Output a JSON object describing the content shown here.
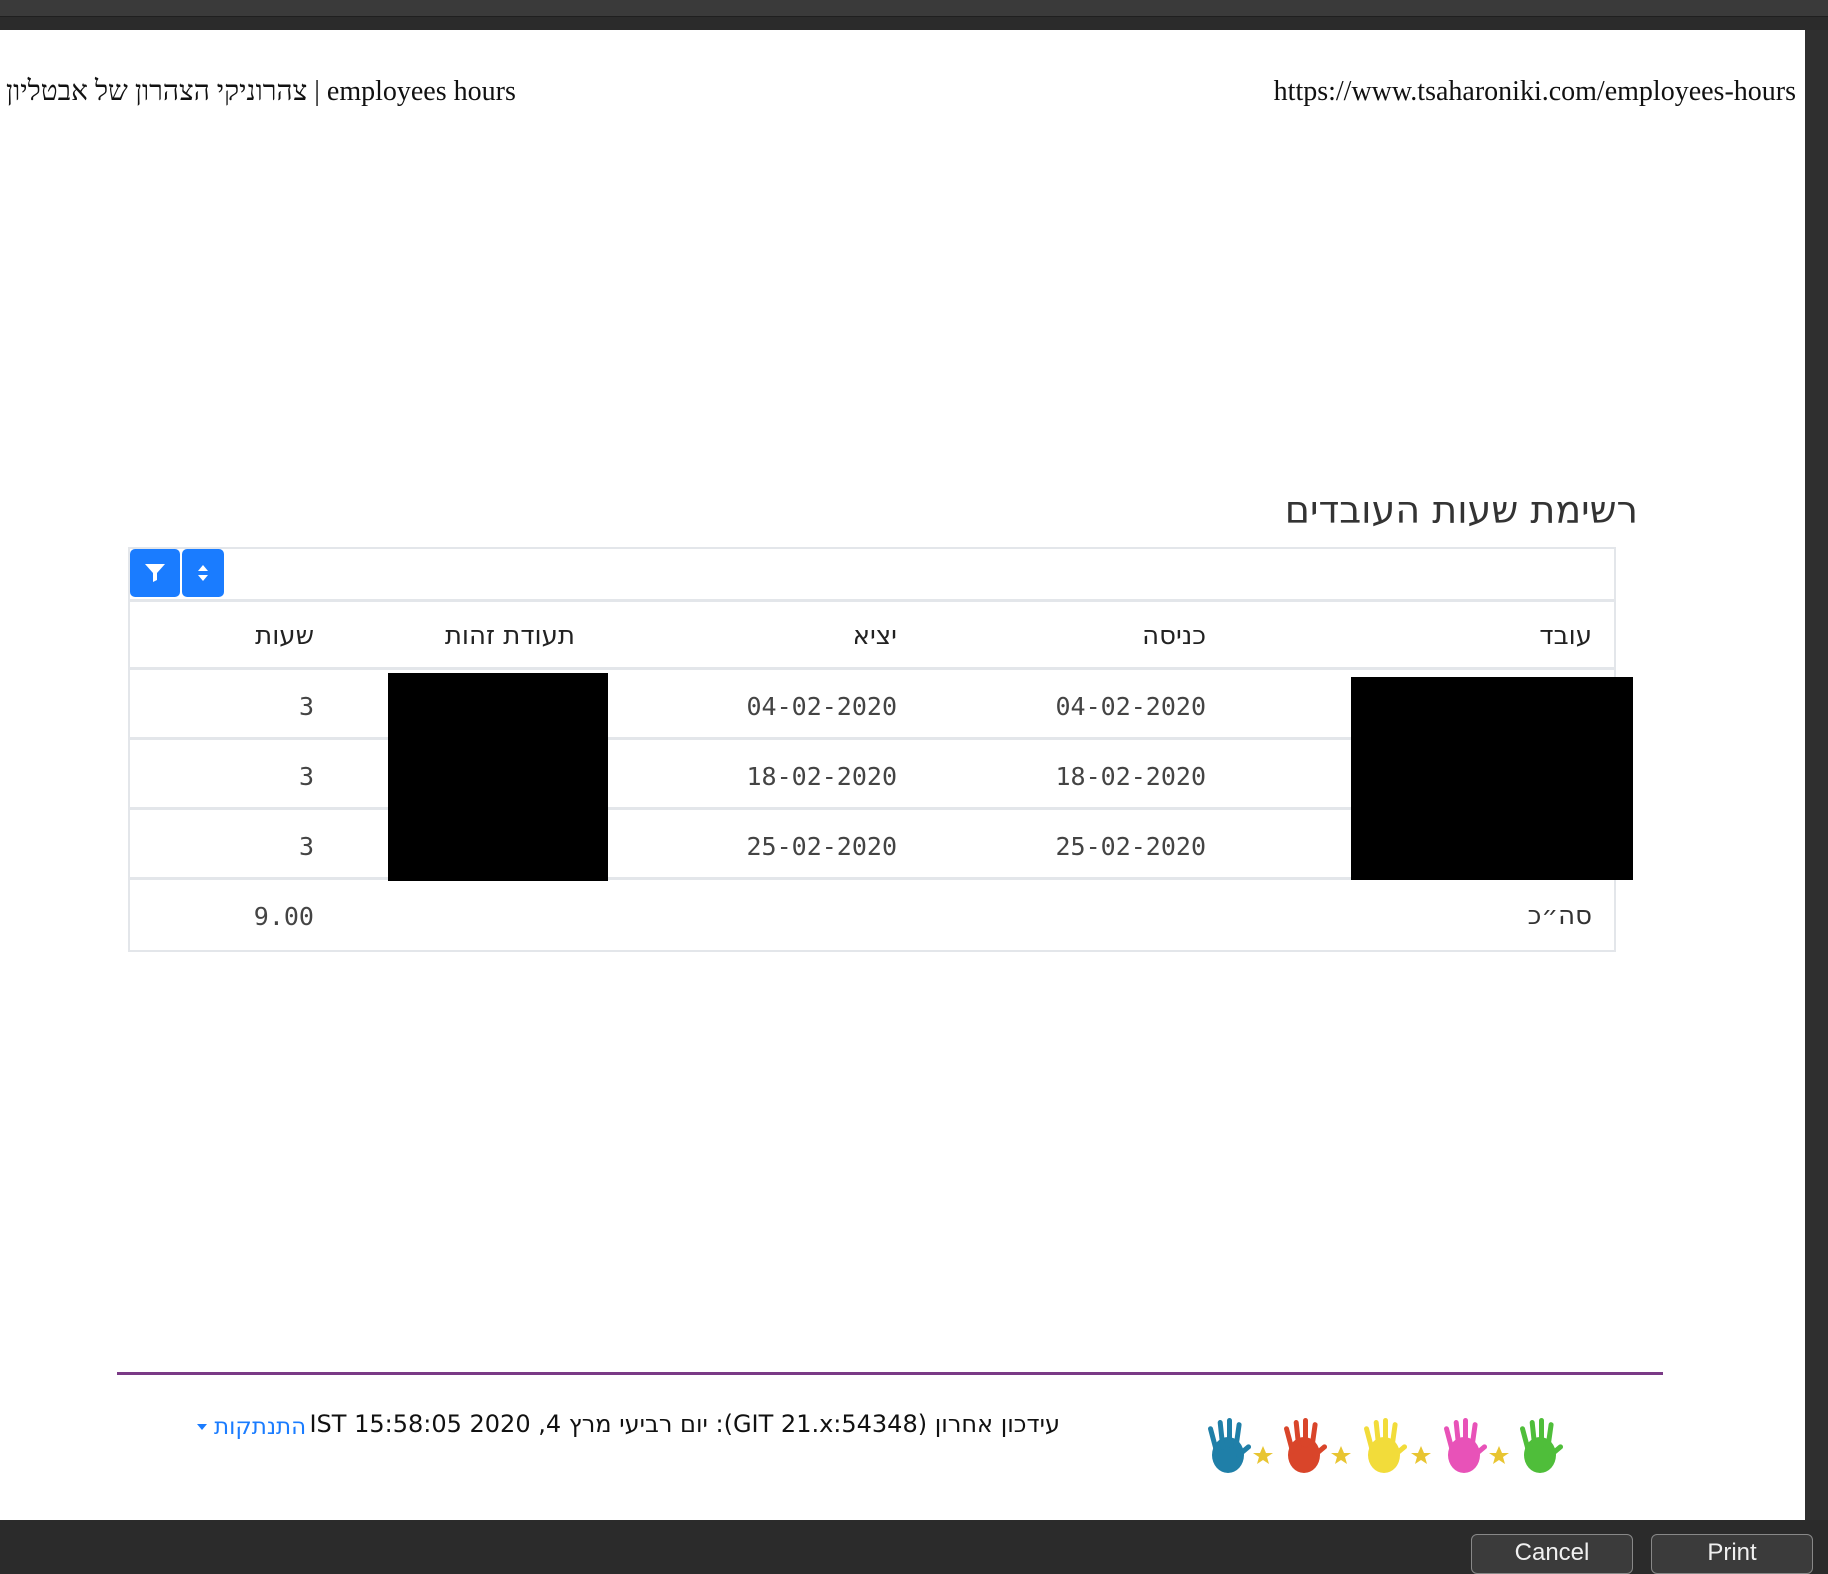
{
  "print_header": {
    "left": "צהרוניקי הצהרון של אבטליון | employees hours",
    "right": "https://www.tsaharoniki.com/employees-hours"
  },
  "page": {
    "title": "רשימת שעות העובדים"
  },
  "table": {
    "columns": {
      "worker": "עובד",
      "enter": "כניסה",
      "exit": "יציא",
      "id": "תעודת זהות",
      "hours": "שעות"
    },
    "rows": [
      {
        "enter": "04-02-2020",
        "exit": "04-02-2020",
        "hours": "3"
      },
      {
        "enter": "18-02-2020",
        "exit": "18-02-2020",
        "hours": "3"
      },
      {
        "enter": "25-02-2020",
        "exit": "25-02-2020",
        "hours": "3"
      }
    ],
    "total_label": "סה״כ",
    "total_value": "9.00"
  },
  "footer": {
    "update_label": "עידכון אחרון",
    "update_git": "(GIT 21.x:54348):",
    "update_day": "יום רביעי מרץ",
    "update_date": "4, 2020 15:58:05 IST",
    "logout": "התנתקות"
  },
  "dialog": {
    "cancel": "Cancel",
    "print": "Print"
  },
  "colors": {
    "accent": "#1a7cff",
    "footer_line": "#7a3a86"
  }
}
